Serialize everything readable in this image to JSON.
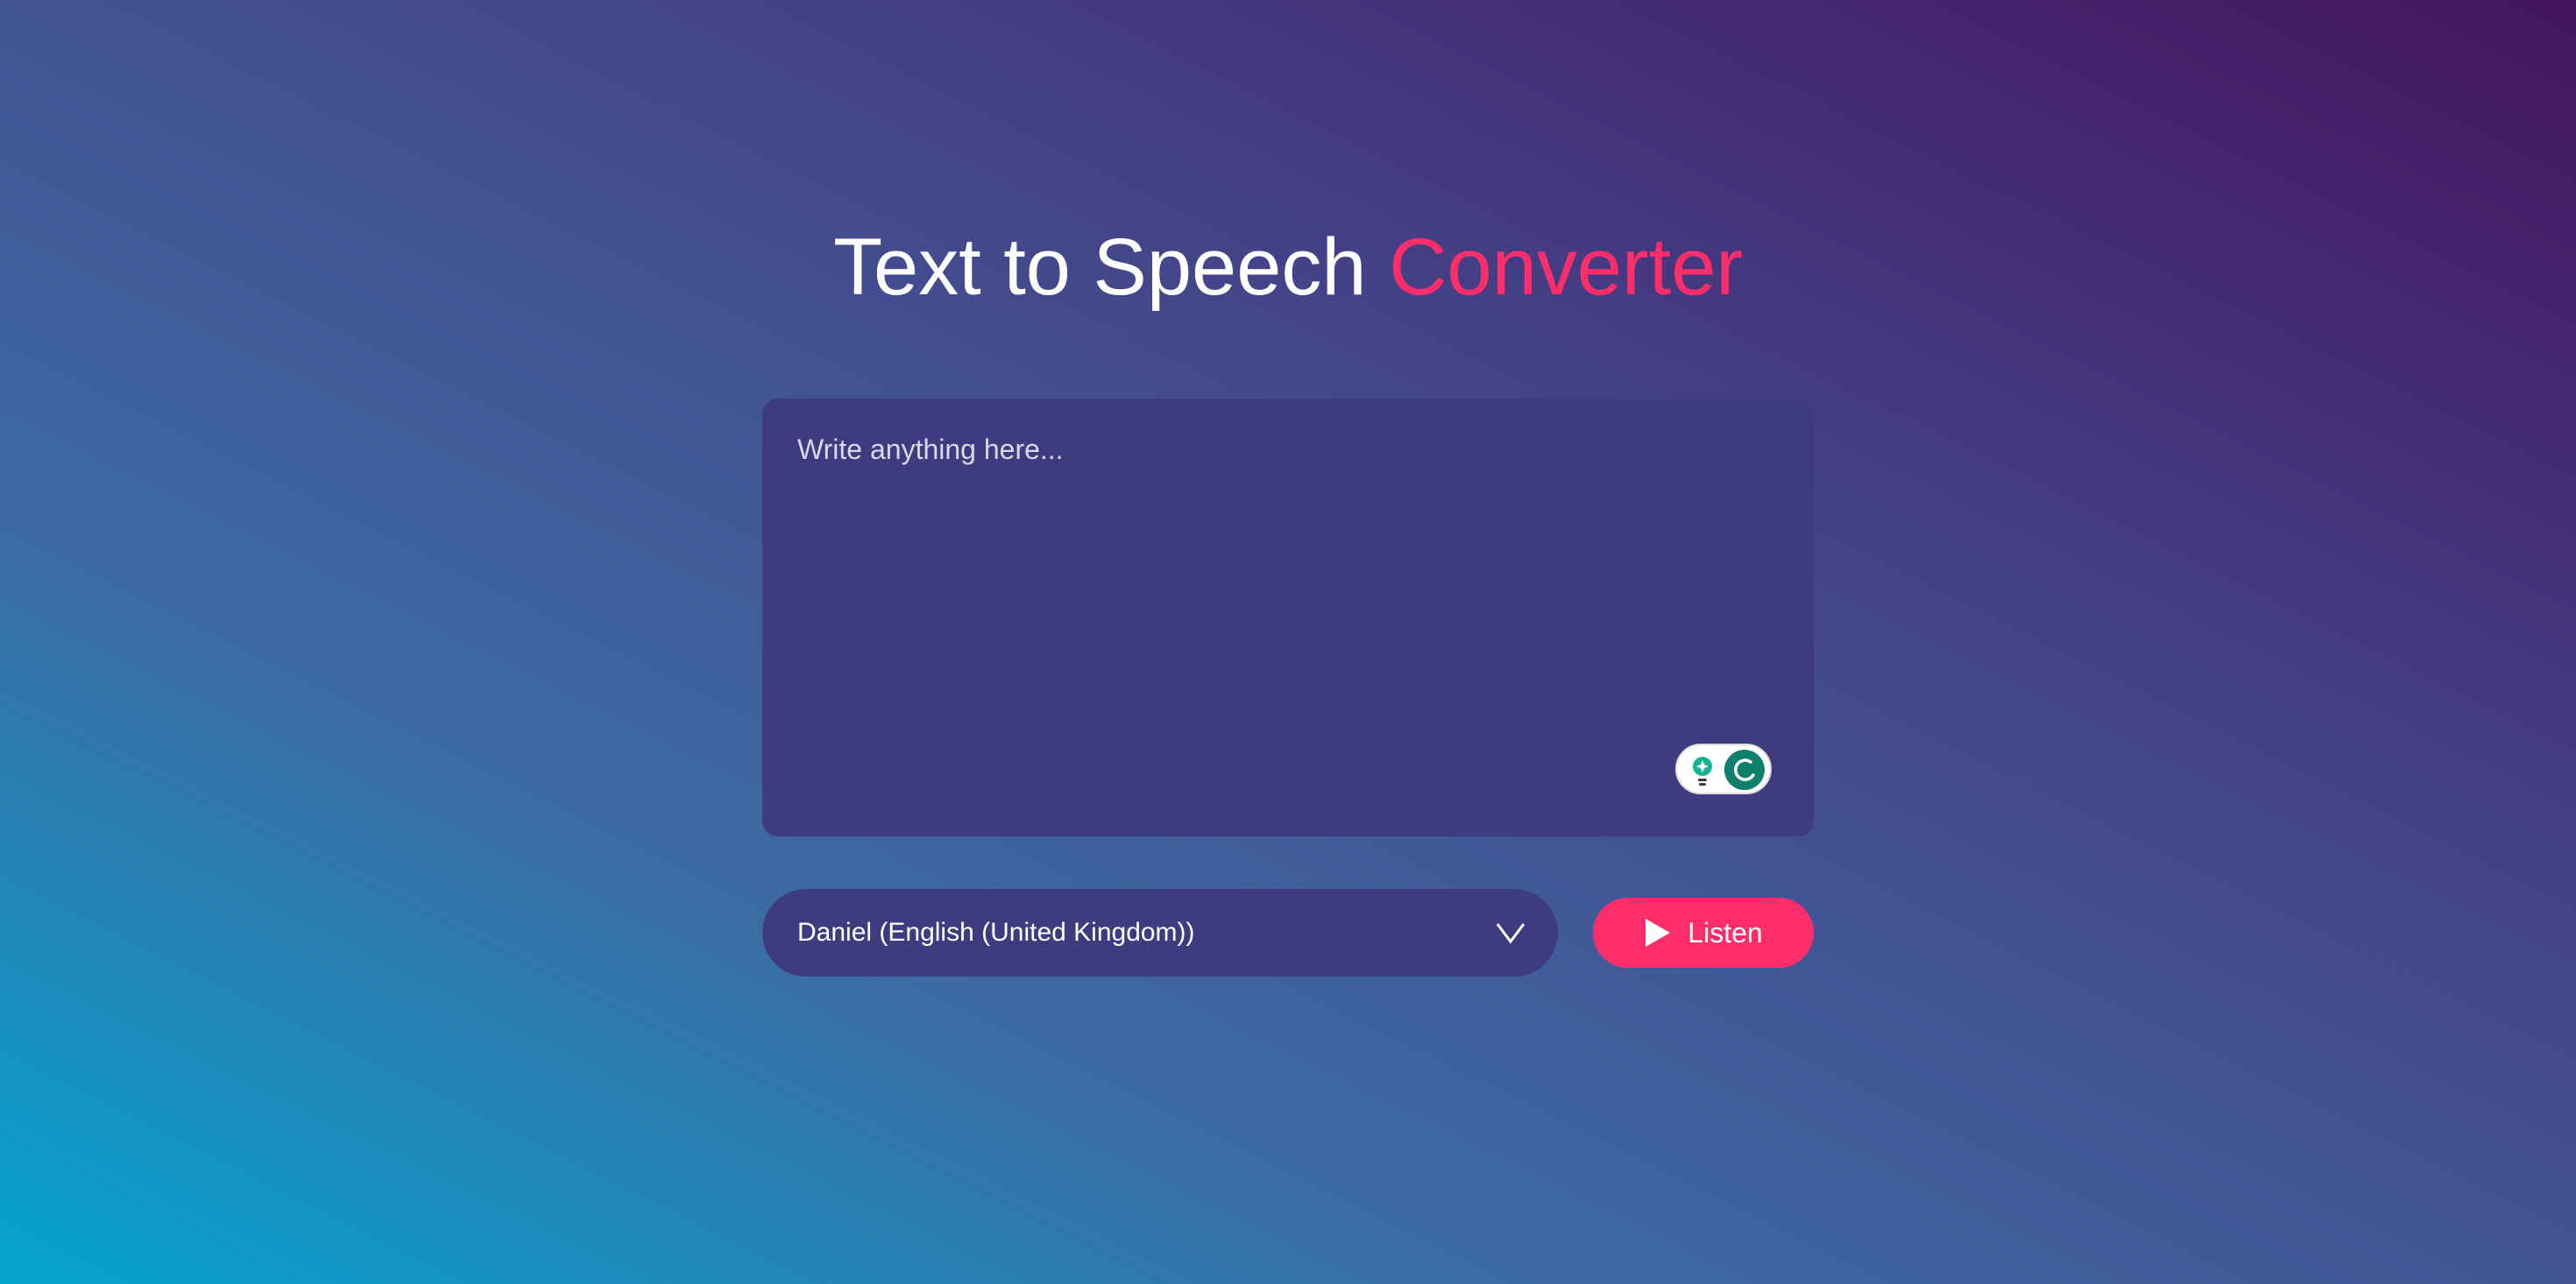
{
  "header": {
    "title_main": "Text to Speech ",
    "title_accent": "Converter"
  },
  "editor": {
    "placeholder": "Write anything here...",
    "value": ""
  },
  "voice_select": {
    "selected": "Daniel (English (United Kingdom))",
    "icon": "chevron-down-icon"
  },
  "listen_button": {
    "label": "Listen",
    "icon": "play-icon"
  },
  "grammar_widget": {
    "icons": [
      "lightbulb-icon",
      "grammar-assistant-icon"
    ]
  },
  "colors": {
    "accent": "#ff2e6a",
    "panel": "#3f3b80",
    "grammar_green": "#0d7f6a"
  }
}
